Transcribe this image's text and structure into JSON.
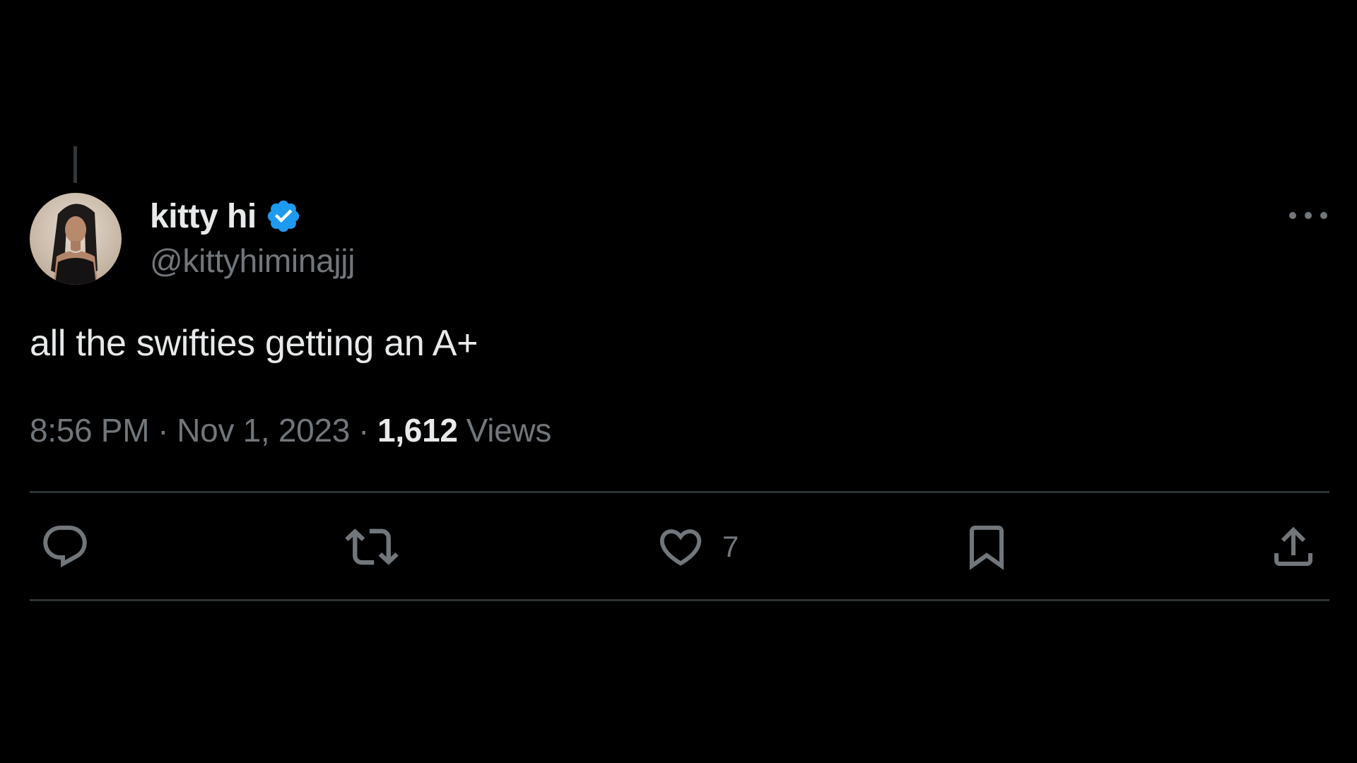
{
  "tweet": {
    "author": {
      "display_name": "kitty hi",
      "handle": "@kittyhiminajjj",
      "verified": true,
      "avatar_icon": "profile-photo-avatar"
    },
    "text": "all the swifties getting an A+",
    "time": "8:56 PM",
    "date": "Nov 1, 2023",
    "separator": "·",
    "views_count": "1,612",
    "views_label": "Views"
  },
  "actions": {
    "reply": {
      "icon": "reply-bubble-icon"
    },
    "retweet": {
      "icon": "retweet-arrows-icon"
    },
    "like": {
      "icon": "heart-icon",
      "count": "7"
    },
    "bookmark": {
      "icon": "bookmark-icon"
    },
    "share": {
      "icon": "share-upload-icon"
    }
  },
  "colors": {
    "background": "#000000",
    "primary_text": "#e7e9ea",
    "secondary_text": "#71767b",
    "divider": "#2f3336",
    "verified_badge": "#1d9bf0"
  }
}
